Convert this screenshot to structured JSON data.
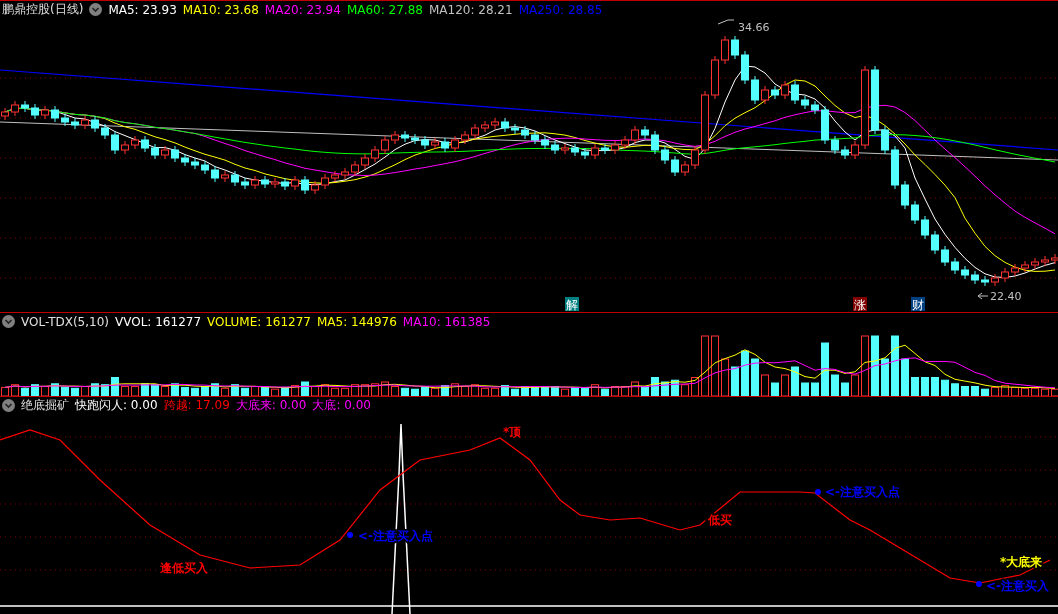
{
  "price_pane": {
    "title": "鹏鼎控股(日线)",
    "indicators": [
      {
        "label": "MA5: 23.93",
        "color": "#ffffff"
      },
      {
        "label": "MA10: 23.68",
        "color": "#ffff00"
      },
      {
        "label": "MA20: 23.94",
        "color": "#ff00ff"
      },
      {
        "label": "MA60: 27.88",
        "color": "#00ff00"
      },
      {
        "label": "MA120: 28.21",
        "color": "#c0c0c0"
      },
      {
        "label": "MA250: 28.85",
        "color": "#0000ff"
      }
    ],
    "high_mark": "34.66",
    "low_mark": "22.40",
    "event_tags": [
      {
        "label": "解",
        "color": "#008080"
      },
      {
        "label": "涨",
        "color": "#800000"
      },
      {
        "label": "财",
        "color": "#004080"
      }
    ]
  },
  "volume_pane": {
    "title": "VOL-TDX(5,10)",
    "indicators": [
      {
        "label": "VVOL: 161277",
        "color": "#ffffff"
      },
      {
        "label": "VOLUME: 161277",
        "color": "#ffff00"
      },
      {
        "label": "MA5: 144976",
        "color": "#ffff00"
      },
      {
        "label": "MA10: 161385",
        "color": "#ff00ff"
      }
    ]
  },
  "indicator_pane": {
    "title": "绝底掘矿",
    "indicators": [
      {
        "label": "快跑闪人: 0.00",
        "color": "#ffffff"
      },
      {
        "label": "跨越: 17.09",
        "color": "#ff0000"
      },
      {
        "label": "大底来: 0.00",
        "color": "#ff00ff"
      },
      {
        "label": "大底: 0.00",
        "color": "#ff00ff"
      }
    ],
    "signals": [
      {
        "text": "逢低买入",
        "color": "#ff0000",
        "kind": "text"
      },
      {
        "text": "<-注意买入点",
        "color": "#0000ff",
        "kind": "dot"
      },
      {
        "text": "*顶",
        "color": "#ff0000",
        "kind": "text"
      },
      {
        "text": "低买",
        "color": "#ff0000",
        "kind": "text"
      },
      {
        "text": "<-注意买入点",
        "color": "#0000ff",
        "kind": "dot"
      },
      {
        "text": "*大底来",
        "color": "#ffff00",
        "kind": "text"
      },
      {
        "text": "<-注意买入",
        "color": "#0000ff",
        "kind": "dot"
      }
    ]
  }
}
